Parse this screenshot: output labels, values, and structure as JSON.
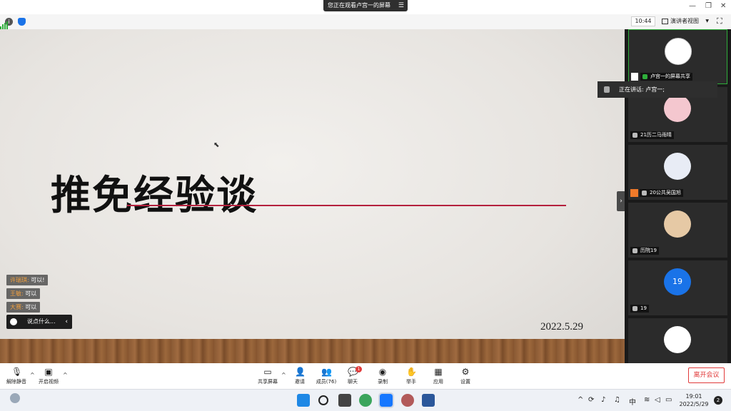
{
  "titlebar": {
    "share_banner": "您正在观看卢宫一的屏幕",
    "menu_glyph": "☰",
    "minimize": "—",
    "restore": "❐",
    "close": "✕"
  },
  "infobar": {
    "timer": "10:44",
    "view_mode": "演讲者视图",
    "view_caret": "▼",
    "fullscreen_glyph": "⛶",
    "info_glyph": "i"
  },
  "slide": {
    "title": "推免经验谈",
    "date": "2022.5.29",
    "line_color": "#b4203d"
  },
  "chat": {
    "messages": [
      {
        "sender": "许瑞琪:",
        "text": "可以!"
      },
      {
        "sender": "王敏:",
        "text": "可以"
      },
      {
        "sender": "大赛:",
        "text": "可以"
      }
    ],
    "input_placeholder": "说点什么...",
    "collapse_glyph": "‹"
  },
  "panel": {
    "handle_glyph": "›",
    "speaking_label": "正在讲话: 卢宫一;",
    "tiles": [
      {
        "name": "卢宫一的屏幕共享",
        "active": true
      },
      {
        "name": "21历二马雨晴"
      },
      {
        "name": "20公共吴国旭"
      },
      {
        "name": "历院19"
      },
      {
        "name": "19",
        "avatar_text": "19"
      },
      {
        "name": ""
      }
    ],
    "avatar_colors": [
      "#ffffff",
      "#f4c7cf",
      "#e8ecf5",
      "#e6c9a5",
      "#1a73e8",
      "#ffffff"
    ]
  },
  "controls": {
    "unmute": "解除静音",
    "start_video": "开启视频",
    "share_screen": "共享屏幕",
    "invite": "邀请",
    "members": "成员(76)",
    "chat": "聊天",
    "record": "录制",
    "raise_hand": "举手",
    "apps": "应用",
    "settings": "设置",
    "leave": "离开会议",
    "chat_badge": "1",
    "chevron": "^"
  },
  "taskbar": {
    "time": "19:01",
    "date": "2022/5/29",
    "ime": "中",
    "notification_count": "2",
    "tray_caret": "^"
  }
}
